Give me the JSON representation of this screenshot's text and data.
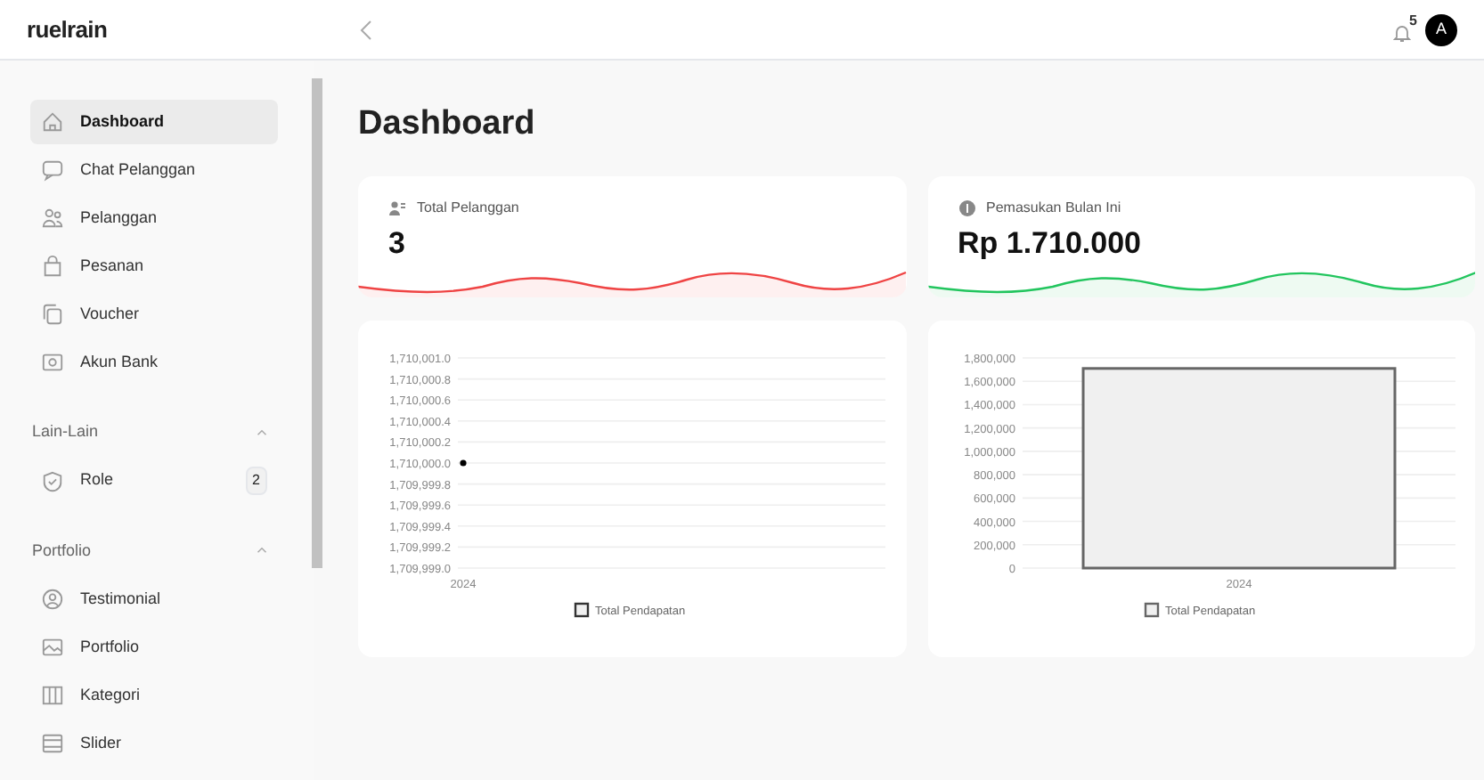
{
  "header": {
    "logo": "ruelrain",
    "notifications": "5",
    "avatar": "A"
  },
  "sidebar": {
    "items": [
      {
        "label": "Dashboard",
        "selected": true
      },
      {
        "label": "Chat Pelanggan",
        "selected": false
      },
      {
        "label": "Pelanggan",
        "selected": false
      },
      {
        "label": "Pesanan",
        "selected": false
      },
      {
        "label": "Voucher",
        "selected": false
      },
      {
        "label": "Akun Bank",
        "selected": false
      }
    ],
    "sections": [
      {
        "title": "Lain-Lain",
        "expanded": true,
        "items": [
          {
            "label": "Role",
            "badge": "2",
            "selected": false
          }
        ]
      },
      {
        "title": "Portfolio",
        "expanded": true,
        "items": [
          {
            "label": "Testimonial",
            "selected": false
          },
          {
            "label": "Portfolio",
            "selected": false
          },
          {
            "label": "Kategori",
            "selected": false
          },
          {
            "label": "Slider",
            "selected": false
          }
        ]
      }
    ]
  },
  "page_title": "Dashboard",
  "stats": [
    {
      "label": "Total Pelanggan",
      "value": "3",
      "color": "#ef4444"
    },
    {
      "label": "Pemasukan Bulan Ini",
      "value": "Rp 1.710.000",
      "color": "#22c55e"
    }
  ],
  "charts": [
    {
      "chart_data": {
        "type": "line",
        "grid": true,
        "categories": [
          "2024"
        ],
        "series": [
          {
            "name": "Total Pendapatan",
            "color": "#000000",
            "marker": true,
            "values": [
              1710000
            ]
          }
        ],
        "ylim": [
          1709999,
          1710001
        ],
        "yticks": [
          {
            "value": 1710001,
            "label": "1,710,001.0"
          },
          {
            "value": 1710000.8,
            "label": "1,710,000.8"
          },
          {
            "value": 1710000.6,
            "label": "1,710,000.6"
          },
          {
            "value": 1710000.4,
            "label": "1,710,000.4"
          },
          {
            "value": 1710000.2,
            "label": "1,710,000.2"
          },
          {
            "value": 1710000,
            "label": "1,710,000.0"
          },
          {
            "value": 1709999.8,
            "label": "1,709,999.8"
          },
          {
            "value": 1709999.6,
            "label": "1,709,999.6"
          },
          {
            "value": 1709999.4,
            "label": "1,709,999.4"
          },
          {
            "value": 1709999.2,
            "label": "1,709,999.2"
          },
          {
            "value": 1709999,
            "label": "1,709,999.0"
          }
        ]
      }
    },
    {
      "chart_data": {
        "type": "bar",
        "grid": true,
        "categories": [
          "2024"
        ],
        "series": [
          {
            "name": "Total Pendapatan",
            "color": "#666666",
            "values": [
              1710000
            ]
          }
        ],
        "ylim": [
          0,
          1800000
        ],
        "yticks": [
          {
            "value": 1800000,
            "label": "1,800,000"
          },
          {
            "value": 1600000,
            "label": "1,600,000"
          },
          {
            "value": 1400000,
            "label": "1,400,000"
          },
          {
            "value": 1200000,
            "label": "1,200,000"
          },
          {
            "value": 1000000,
            "label": "1,000,000"
          },
          {
            "value": 800000,
            "label": "800,000"
          },
          {
            "value": 600000,
            "label": "600,000"
          },
          {
            "value": 400000,
            "label": "400,000"
          },
          {
            "value": 200000,
            "label": "200,000"
          },
          {
            "value": 0,
            "label": "0"
          }
        ]
      }
    }
  ]
}
